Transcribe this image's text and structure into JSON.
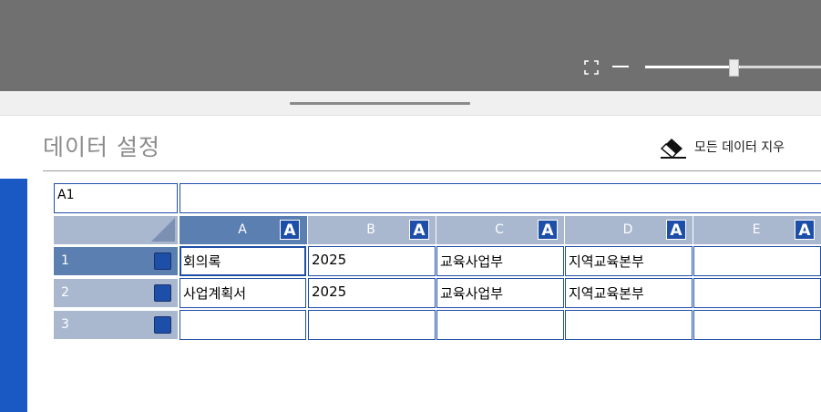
{
  "page": {
    "title": "데이터 설정",
    "clear_all_label": "모든 데이터 지우"
  },
  "toolbar": {
    "icons": [
      "expand-icon",
      "zoom-out-icon",
      "zoom-slider"
    ]
  },
  "sheet": {
    "cell_reference": "A1",
    "formula_value": "",
    "active_cell": "A1",
    "column_badge": "A",
    "columns": [
      {
        "letter": "A",
        "selected": true
      },
      {
        "letter": "B",
        "selected": false
      },
      {
        "letter": "C",
        "selected": false
      },
      {
        "letter": "D",
        "selected": false
      },
      {
        "letter": "E",
        "selected": false
      }
    ],
    "rows": [
      {
        "num": "1",
        "cells": [
          "회의록",
          "2025",
          "교육사업부",
          "지역교육본부",
          ""
        ]
      },
      {
        "num": "2",
        "cells": [
          "사업계획서",
          "2025",
          "교육사업부",
          "지역교육본부",
          ""
        ]
      },
      {
        "num": "3",
        "cells": [
          "",
          "",
          "",
          "",
          ""
        ]
      }
    ]
  },
  "colors": {
    "accent": "#1e4fa8",
    "header_bg": "#a9b7cf",
    "header_selected_bg": "#5b7fb1",
    "topbar_bg": "#707070",
    "left_strip": "#1a59c4"
  }
}
